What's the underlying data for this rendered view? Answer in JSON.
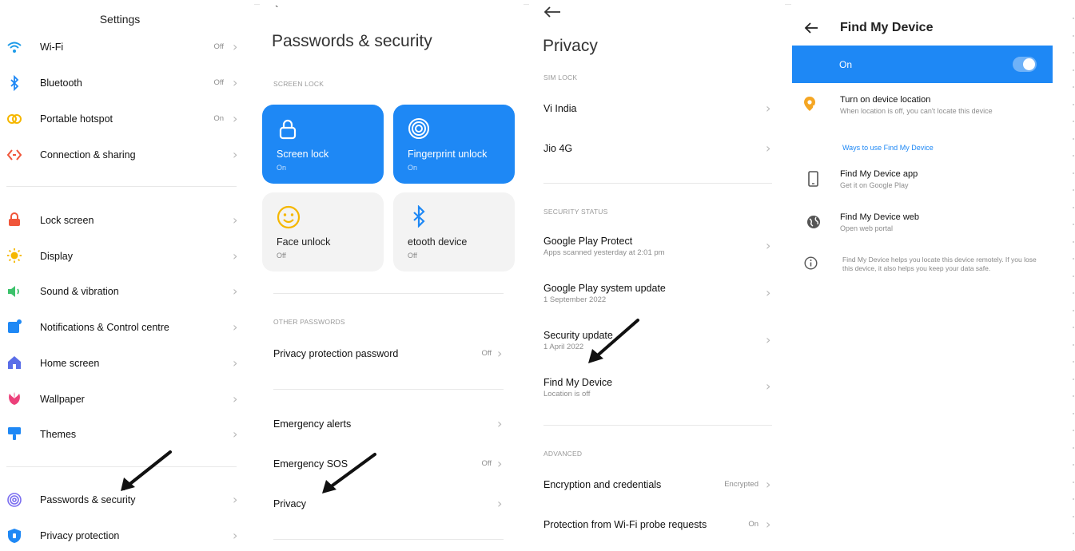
{
  "settings": {
    "title": "Settings",
    "items": [
      {
        "label": "Wi-Fi",
        "status": "Off"
      },
      {
        "label": "Bluetooth",
        "status": "Off"
      },
      {
        "label": "Portable hotspot",
        "status": "On"
      },
      {
        "label": "Connection & sharing",
        "status": ""
      },
      {
        "label": "Lock screen",
        "status": ""
      },
      {
        "label": "Display",
        "status": ""
      },
      {
        "label": "Sound & vibration",
        "status": ""
      },
      {
        "label": "Notifications & Control centre",
        "status": ""
      },
      {
        "label": "Home screen",
        "status": ""
      },
      {
        "label": "Wallpaper",
        "status": ""
      },
      {
        "label": "Themes",
        "status": ""
      },
      {
        "label": "Passwords & security",
        "status": ""
      },
      {
        "label": "Privacy protection",
        "status": ""
      }
    ]
  },
  "passwords": {
    "back": "`",
    "title": "Passwords & security",
    "screen_lock_section": "SCREEN LOCK",
    "tiles": [
      {
        "label": "Screen lock",
        "status": "On"
      },
      {
        "label": "Fingerprint unlock",
        "status": "On"
      },
      {
        "label": "Face unlock",
        "status": "Off"
      },
      {
        "label": "etooth device",
        "status": "Off"
      }
    ],
    "other_section": "OTHER PASSWORDS",
    "rows": [
      {
        "label": "Privacy protection password",
        "status": "Off"
      },
      {
        "label": "Emergency alerts",
        "status": ""
      },
      {
        "label": "Emergency SOS",
        "status": "Off"
      },
      {
        "label": "Privacy",
        "status": ""
      }
    ]
  },
  "privacy": {
    "back_icon": "arrow-left-icon",
    "title": "Privacy",
    "sim_section": "SIM LOCK",
    "sims": [
      "Vi India",
      "Jio 4G"
    ],
    "security_section": "SECURITY STATUS",
    "security_rows": [
      {
        "label": "Google Play Protect",
        "sub": "Apps scanned yesterday at 2:01 pm"
      },
      {
        "label": "Google Play system update",
        "sub": "1 September 2022"
      },
      {
        "label": "Security update",
        "sub": "1 April 2022"
      },
      {
        "label": "Find My Device",
        "sub": "Location is off"
      }
    ],
    "advanced_section": "ADVANCED",
    "advanced_rows": [
      {
        "label": "Encryption and credentials",
        "status": "Encrypted"
      },
      {
        "label": "Protection from Wi-Fi probe requests",
        "status": "On"
      }
    ]
  },
  "fmd": {
    "title": "Find My Device",
    "toggle_label": "On",
    "toggle_on": true,
    "location_title": "Turn on device location",
    "location_sub": "When location is off, you can't locate this device",
    "ways_link": "Ways to use Find My Device",
    "app_title": "Find My Device app",
    "app_sub": "Get it on Google Play",
    "web_title": "Find My Device web",
    "web_sub": "Open web portal",
    "info": "Find My Device helps you locate this device remotely. If you lose this device, it also helps you keep your data safe."
  },
  "colors": {
    "accent": "#1e88f5",
    "location_icon": "#f5a623"
  }
}
